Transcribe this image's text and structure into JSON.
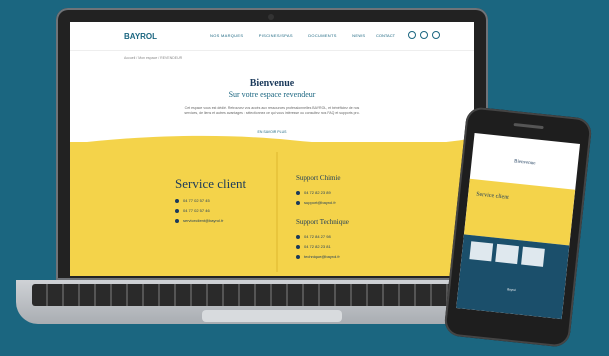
{
  "site": {
    "logo": "BAYROL",
    "menu": [
      "NOS MARQUES",
      "PISCINES/SPAS",
      "DOCUMENTS",
      "NEWS"
    ],
    "contact": "CONTACT",
    "breadcrumb": "Accueil / Mon espace / REVENDEUR",
    "hero_title": "Bienvenue",
    "hero_subtitle": "Sur votre espace revendeur",
    "hero_text": "Cet espace vous est dédié. Retrouvez vos accès aux ressources professionnelles BAYROL, et bénéficiez de nos services, de liens et autres avantages : sélectionnez ce qui vous intéresse ou consultez nos FAQ et supports pro.",
    "hero_link": "EN SAVOIR PLUS",
    "service_title": "Service client",
    "service_lines": [
      "04 77 02 57 45",
      "04 77 02 57 46",
      "serviceclient@bayrol.fr"
    ],
    "support_chimie_title": "Support Chimie",
    "support_chimie_lines": [
      "04 72 82 23 89",
      "support@bayrol.fr"
    ],
    "support_tech_title": "Support Technique",
    "support_tech_lines": [
      "04 72 84 27 98",
      "04 72 82 23 81",
      "technique@bayrol.fr"
    ]
  },
  "phone": {
    "title": "Bienvenue",
    "service_title": "Service client",
    "footer": "Bayrol"
  },
  "colors": {
    "background": "#1b6680",
    "yellow": "#f4d34a",
    "navy": "#1b3a5b"
  }
}
